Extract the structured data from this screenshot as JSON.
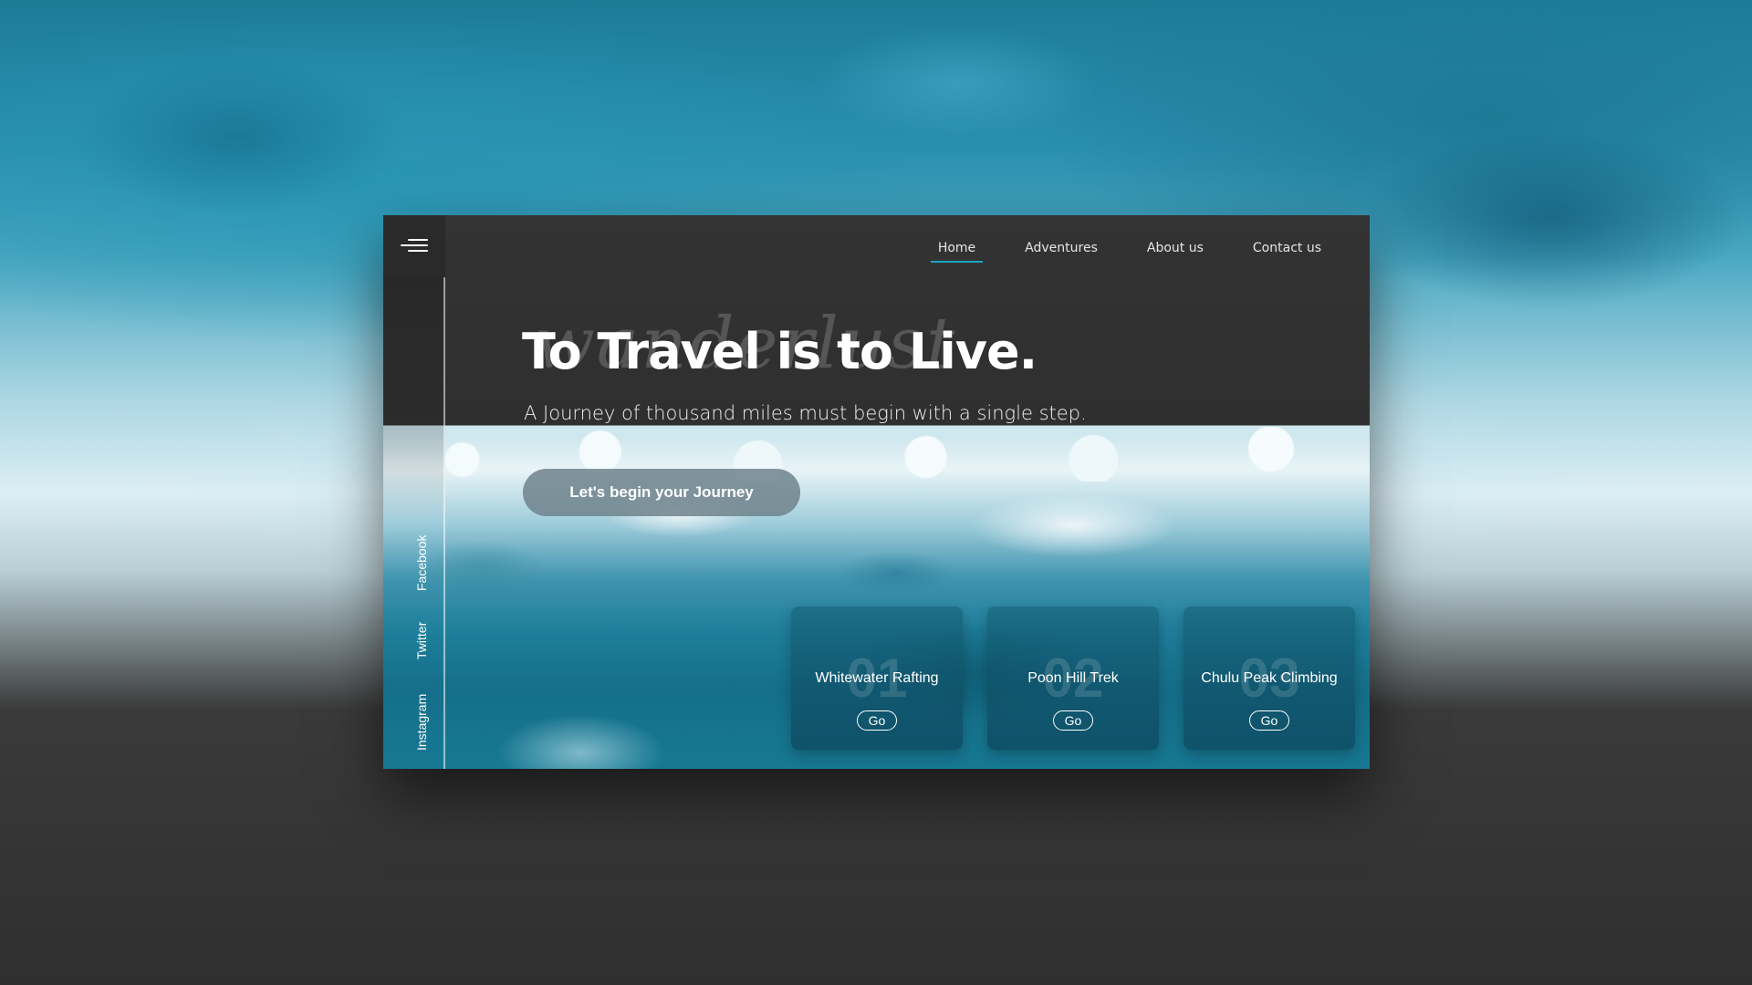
{
  "sidebar": {
    "social_links": [
      "Facebook",
      "Twitter",
      "Instagram"
    ]
  },
  "nav": {
    "items": [
      "Home",
      "Adventures",
      "About us",
      "Contact us"
    ],
    "active": "Home"
  },
  "hero": {
    "ghost_text": "wanderlust",
    "title": "To Travel is to Live.",
    "subtitle": "A Journey of thousand miles must begin with a single step.",
    "cta_label": "Let's begin your Journey"
  },
  "cards": [
    {
      "number": "01",
      "title": "Whitewater Rafting",
      "button": "Go"
    },
    {
      "number": "02",
      "title": "Poon Hill Trek",
      "button": "Go"
    },
    {
      "number": "03",
      "title": "Chulu Peak Climbing",
      "button": "Go"
    }
  ],
  "colors": {
    "accent": "#1aa3c2",
    "dark": "#2e2e2e",
    "sea": "#156f8a"
  },
  "icons": {
    "menu": "hamburger-menu-icon"
  }
}
